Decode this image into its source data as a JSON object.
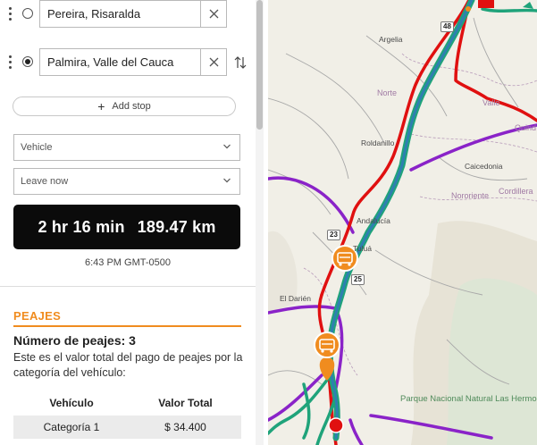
{
  "stops": [
    {
      "value": "Pereira, Risaralda",
      "selected": false
    },
    {
      "value": "Palmira, Valle del Cauca",
      "selected": true
    }
  ],
  "add_stop_label": "Add stop",
  "vehicle_select": {
    "value": "Vehicle"
  },
  "time_select": {
    "value": "Leave now"
  },
  "summary": {
    "duration": "2 hr 16 min",
    "distance": "189.47 km"
  },
  "arrival_time": "6:43 PM GMT-0500",
  "tolls": {
    "title": "PEAJES",
    "count_text": "Número de peajes: 3",
    "description": "Este es el valor total del pago de peajes por la categoría del vehículo:",
    "table": {
      "headers": [
        "Vehículo",
        "Valor Total"
      ],
      "rows": [
        [
          "Categoría 1",
          "$ 34.400"
        ]
      ]
    }
  },
  "map": {
    "labels": {
      "argelia": "Argelia",
      "norte": "Norte",
      "valle": "Valle",
      "quind": "Quind",
      "roldanillo": "Roldanillo",
      "caicedonia": "Caicedonia",
      "nororiente": "Nororiente",
      "cordillera": "Cordillera",
      "andalucia": "Andalucía",
      "tulua": "Tuluá",
      "darien": "El Darién",
      "parque": "Parque Nacional Natural Las Hermosas"
    },
    "shields": {
      "r48": "48",
      "r23": "23",
      "r25": "25"
    },
    "colors": {
      "toll_marker": "#f08c1f",
      "route": "#2f7fb0",
      "red_road": "#e01010",
      "purple_road": "#8a23c8",
      "green_road": "#1fa37a"
    }
  }
}
